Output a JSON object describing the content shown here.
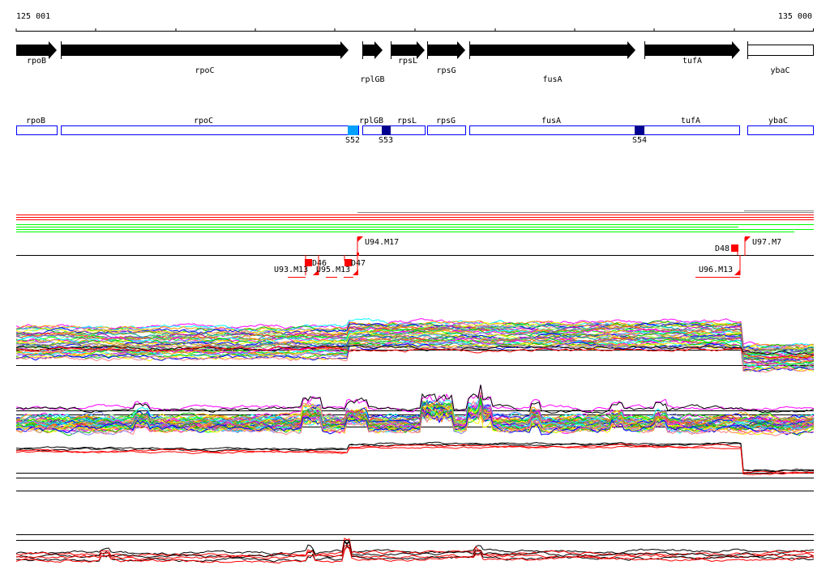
{
  "ruler": {
    "start_label": "125 001",
    "end_label": "135 000"
  },
  "genes": [
    {
      "name": "rpoB",
      "type": "arrow"
    },
    {
      "name": "rpoC",
      "type": "arrow"
    },
    {
      "name": "rplGB",
      "type": "arrow"
    },
    {
      "name": "rpsL",
      "type": "arrow"
    },
    {
      "name": "rpsG",
      "type": "arrow"
    },
    {
      "name": "fusA",
      "type": "arrow"
    },
    {
      "name": "tufA",
      "type": "arrow"
    },
    {
      "name": "ybaC",
      "type": "box"
    }
  ],
  "segments": {
    "gene_labels": [
      "rpoB",
      "rpoC",
      "rplGB",
      "rpsL",
      "rpsG",
      "fusA",
      "tufA",
      "ybaC"
    ],
    "sites": [
      {
        "label": "S52",
        "color": "#00a0ff"
      },
      {
        "label": "S53",
        "color": "#000090"
      },
      {
        "label": "S54",
        "color": "#000090"
      }
    ]
  },
  "markers": [
    "U94.M17",
    "D46",
    "U93.M13",
    "D47",
    "U95.M13",
    "D48",
    "U97.M7",
    "U96.M13"
  ],
  "colors": {
    "box_outline": "#0000ff",
    "marker": "#ff0000",
    "red_lines": "#ff0000",
    "green_lines": "#00ff00"
  }
}
